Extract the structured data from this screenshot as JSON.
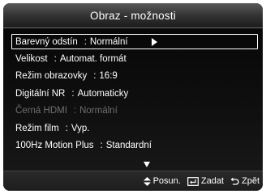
{
  "window": {
    "title": "Obraz - možnosti"
  },
  "menu": {
    "items": [
      {
        "label": "Barevný odstín",
        "value": "Normální",
        "selected": true,
        "enabled": true
      },
      {
        "label": "Velikost",
        "value": "Automat. formát",
        "selected": false,
        "enabled": true
      },
      {
        "label": "Režim obrazovky",
        "value": "16:9",
        "selected": false,
        "enabled": true
      },
      {
        "label": "Digitální NR",
        "value": "Automaticky",
        "selected": false,
        "enabled": true
      },
      {
        "label": "Černá HDMI",
        "value": "Normální",
        "selected": false,
        "enabled": false
      },
      {
        "label": "Režim film",
        "value": "Vyp.",
        "selected": false,
        "enabled": true
      },
      {
        "label": "100Hz Motion Plus",
        "value": "Standardní",
        "selected": false,
        "enabled": true
      }
    ],
    "separator": ":"
  },
  "footer": {
    "move_label": "Posun.",
    "enter_label": "Zadat",
    "back_label": "Zpět"
  },
  "icons": {
    "selected_arrow": "arrow-right-icon",
    "scroll": "scroll-down-icon",
    "move": "up-down-arrow-icon",
    "enter": "enter-icon",
    "back": "return-icon"
  },
  "colors": {
    "background": "#0d0d0d",
    "text": "#ffffff",
    "disabled_text": "#6f6f6f",
    "title_bar": "#3a3a3a"
  }
}
